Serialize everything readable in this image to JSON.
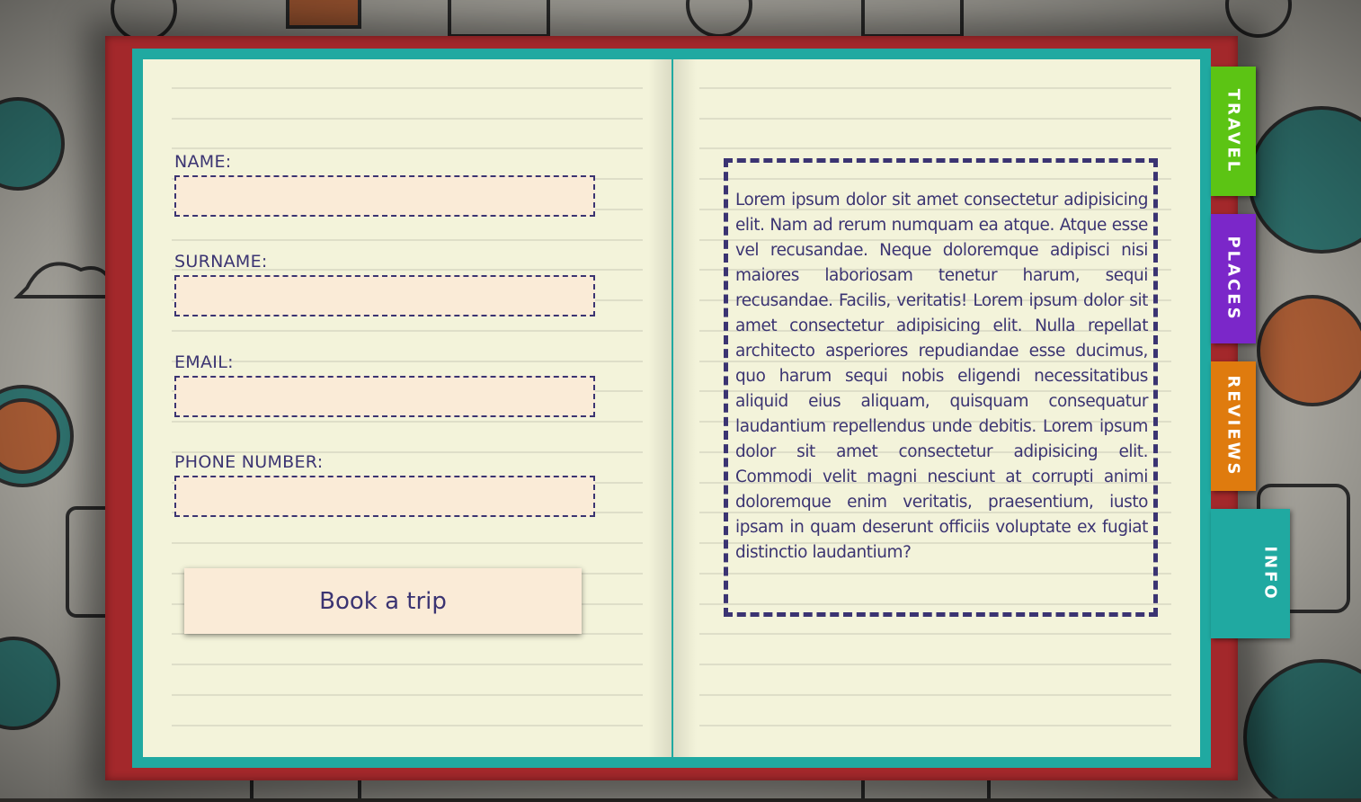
{
  "form": {
    "name_label": "NAME:",
    "surname_label": "SURNAME:",
    "email_label": "EMAIL:",
    "phone_label": "PHONE NUMBER:",
    "name_value": "",
    "surname_value": "",
    "email_value": "",
    "phone_value": "",
    "submit_label": "Book a trip"
  },
  "info_text": "Lorem ipsum dolor sit amet consectetur adipisicing elit. Nam ad rerum numquam ea atque. Atque esse vel recusandae. Neque doloremque adipisci nisi maiores laboriosam tenetur harum, sequi recusandae. Facilis, veritatis! Lorem ipsum dolor sit amet consectetur adipisicing elit. Nulla repellat architecto asperiores repudiandae esse ducimus, quo harum sequi nobis eligendi necessitatibus aliquid eius aliquam, quisquam consequatur laudantium repellendus unde debitis. Lorem ipsum dolor sit amet consectetur adipisicing elit. Commodi velit magni nesciunt at corrupti animi doloremque enim veritatis, praesentium, iusto ipsam in quam deserunt officiis voluptate ex fugiat distinctio laudantium?",
  "tabs": [
    {
      "label": "TRAVEL",
      "color": "#5cc414",
      "active": false
    },
    {
      "label": "PLACES",
      "color": "#7b27c9",
      "active": false
    },
    {
      "label": "REVIEWS",
      "color": "#df7b0e",
      "active": false
    },
    {
      "label": "INFO",
      "color": "#20a9a1",
      "active": true
    }
  ],
  "colors": {
    "cover": "#a3282b",
    "frame": "#20a9a1",
    "paper": "#f3f3da",
    "ink": "#3b3472",
    "input_bg": "#faebd7"
  }
}
